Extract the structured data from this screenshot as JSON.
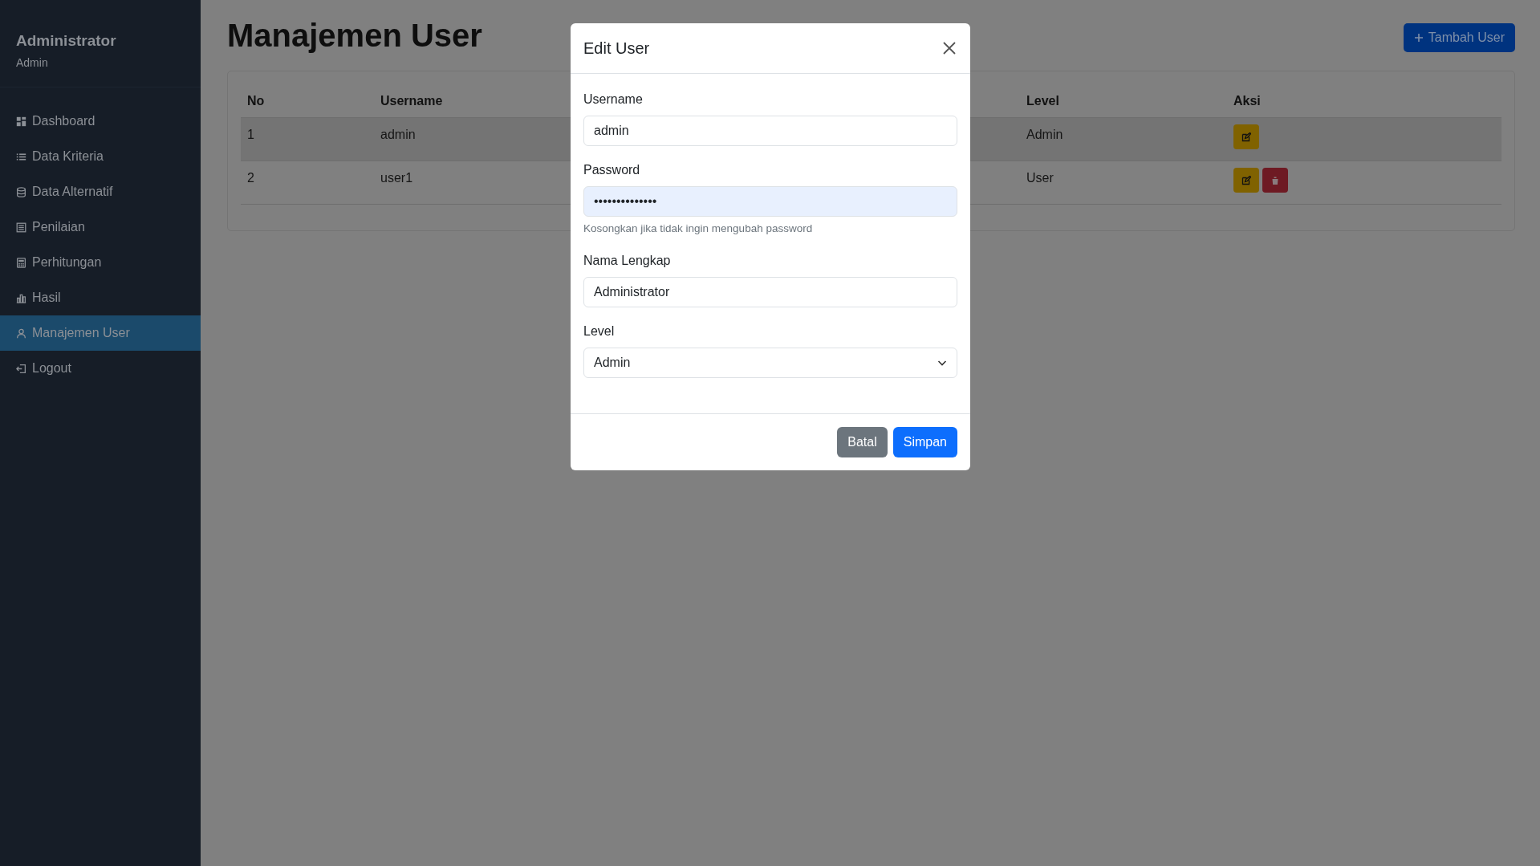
{
  "sidebar": {
    "title": "Administrator",
    "subtitle": "Admin",
    "items": [
      {
        "label": "Dashboard",
        "selected": false
      },
      {
        "label": "Data Kriteria",
        "selected": false
      },
      {
        "label": "Data Alternatif",
        "selected": false
      },
      {
        "label": "Penilaian",
        "selected": false
      },
      {
        "label": "Perhitungan",
        "selected": false
      },
      {
        "label": "Hasil",
        "selected": false
      },
      {
        "label": "Manajemen User",
        "selected": true
      },
      {
        "label": "Logout",
        "selected": false
      }
    ]
  },
  "page": {
    "title": "Manajemen User",
    "add_button": "Tambah User"
  },
  "table": {
    "columns": [
      "No",
      "Username",
      "Level",
      "Aksi"
    ],
    "rows": [
      {
        "no": "1",
        "username": "admin",
        "level": "Admin",
        "selected": true,
        "actions": [
          {
            "kind": "edit"
          }
        ]
      },
      {
        "no": "2",
        "username": "user1",
        "level": "User",
        "selected": false,
        "actions": [
          {
            "kind": "edit"
          },
          {
            "kind": "delete"
          }
        ]
      }
    ]
  },
  "modal": {
    "title": "Edit User",
    "fields": [
      {
        "kind": "text",
        "label": "Username",
        "value": "admin"
      },
      {
        "kind": "password",
        "label": "Password",
        "value": "••••••••••••••",
        "hint": "Kosongkan jika tidak ingin mengubah password"
      },
      {
        "kind": "text",
        "label": "Nama Lengkap",
        "value": "Administrator"
      },
      {
        "kind": "select",
        "label": "Level",
        "value": "Admin"
      }
    ],
    "buttons": [
      {
        "kind": "secondary",
        "label": "Batal"
      },
      {
        "kind": "primary",
        "label": "Simpan"
      }
    ]
  }
}
